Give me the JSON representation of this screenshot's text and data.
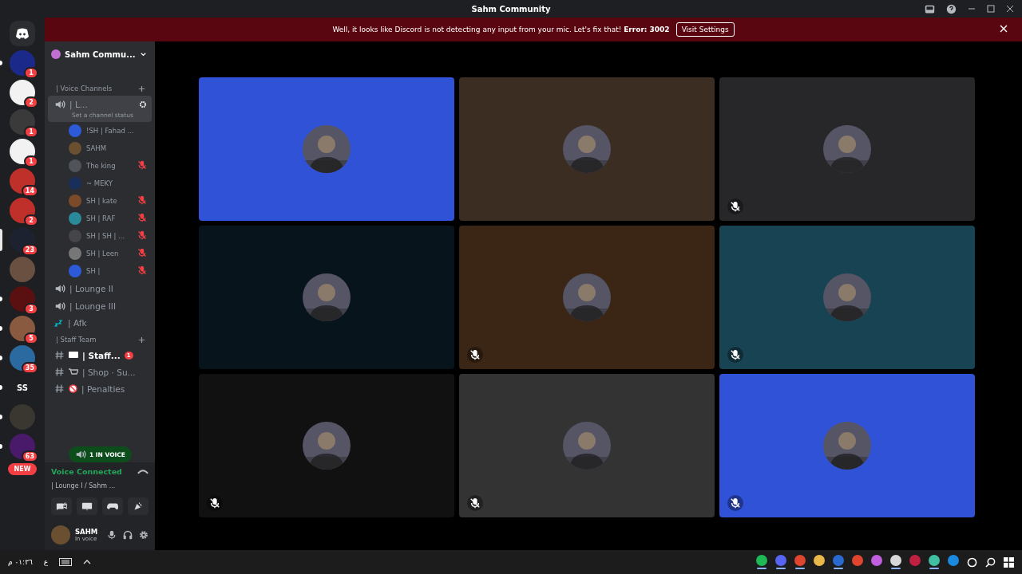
{
  "window": {
    "title": "Sahm Community"
  },
  "banner": {
    "message": "Well, it looks like Discord is not detecting any input from your mic. Let's fix that!  **Error: 3002**",
    "button": "Visit Settings"
  },
  "servers": [
    {
      "badge": "1",
      "color": "#1b2a8a",
      "unread": true,
      "selected": false
    },
    {
      "badge": "2",
      "color": "#f2f2f2",
      "unread": false,
      "selected": false
    },
    {
      "badge": "1",
      "color": "#3a3a3a",
      "unread": false,
      "selected": false
    },
    {
      "badge": "1",
      "color": "#f2f2f2",
      "unread": false,
      "selected": false
    },
    {
      "badge": "14",
      "color": "#c0302a",
      "unread": false,
      "selected": false
    },
    {
      "badge": "2",
      "color": "#c0302a",
      "unread": false,
      "selected": false
    },
    {
      "badge": "23",
      "color": "#1c2230",
      "unread": false,
      "selected": true
    },
    {
      "color": "#6a5040",
      "unread": false,
      "selected": false
    },
    {
      "badge": "3",
      "color": "#5a1010",
      "unread": true,
      "selected": false
    },
    {
      "badge": "5",
      "color": "#8a5a40",
      "unread": true,
      "selected": false
    },
    {
      "badge": "35",
      "color": "#2a6aa0",
      "unread": true,
      "selected": false
    },
    {
      "label": "SS",
      "color": "#1e1f22",
      "unread": true,
      "selected": false
    },
    {
      "color": "#3a3630",
      "unread": true,
      "selected": false
    },
    {
      "badge": "63",
      "color": "#4a1a6a",
      "unread": true,
      "selected": false
    }
  ],
  "new_pill": "NEW",
  "server_header": {
    "name": "Sahm Commu..."
  },
  "categories": [
    {
      "name": "| Voice Channels",
      "channels": [
        {
          "kind": "voice",
          "name": "| L...",
          "selected": true,
          "status": "Set a channel status",
          "members": [
            {
              "name": "!SH | Fahad ...",
              "muted": false,
              "color": "#2d5bd8"
            },
            {
              "name": "SAHM",
              "muted": false,
              "color": "#6a5030"
            },
            {
              "name": "The king",
              "muted": true,
              "color": "#50545a"
            },
            {
              "name": "~ MEKY",
              "muted": false,
              "color": "#1a2e5a"
            },
            {
              "name": "SH | kate",
              "muted": true,
              "color": "#7a4a2a"
            },
            {
              "name": "SH | RAF",
              "muted": true,
              "color": "#2a8a9a"
            },
            {
              "name": "SH | SH | ...",
              "muted": true,
              "color": "#46464a"
            },
            {
              "name": "SH | Leen",
              "muted": true,
              "color": "#777777"
            },
            {
              "name": "SH |",
              "muted": true,
              "color": "#2d5bd8"
            }
          ]
        },
        {
          "kind": "voice",
          "name": "| Lounge II",
          "selected": false
        },
        {
          "kind": "voice",
          "name": "| Lounge III",
          "selected": false
        },
        {
          "kind": "afk",
          "name": "| Afk",
          "selected": false
        }
      ]
    },
    {
      "name": "| Staff Team",
      "channels": [
        {
          "kind": "text",
          "name": "| Staff...",
          "selected": false,
          "unread": true,
          "badge": "1"
        },
        {
          "kind": "shop",
          "name": "| Shop · Su...",
          "selected": false,
          "unread": false
        },
        {
          "kind": "blocked",
          "name": "| Penalties",
          "selected": false,
          "unread": false
        }
      ]
    }
  ],
  "voice_pill": "1 IN VOICE",
  "voice_panel": {
    "status": "Voice Connected",
    "channel": "| Lounge I / Sahm ..."
  },
  "user": {
    "name": "SAHM",
    "status": "In voice"
  },
  "tiles": [
    {
      "color": "#2f52d6",
      "muted": false
    },
    {
      "color": "#3b2d21",
      "muted": false
    },
    {
      "color": "#27272a",
      "muted": true
    },
    {
      "color": "#08141c",
      "muted": false
    },
    {
      "color": "#3b2615",
      "muted": true
    },
    {
      "color": "#184352",
      "muted": true
    },
    {
      "color": "#111111",
      "muted": true
    },
    {
      "color": "#333333",
      "muted": true
    },
    {
      "color": "#2f52d6",
      "muted": true
    }
  ],
  "taskbar": {
    "clock": "٠١:٣٦ م",
    "language": "ع",
    "apps": [
      {
        "color": "#1db954",
        "running": true
      },
      {
        "color": "#5865f2",
        "running": true
      },
      {
        "color": "#e0452f",
        "running": true
      },
      {
        "color": "#e8b84a",
        "running": false
      },
      {
        "color": "#2a6ad0",
        "running": true
      },
      {
        "color": "#e0452f",
        "running": false
      },
      {
        "color": "#c060e0",
        "running": false
      },
      {
        "color": "#d8d8d8",
        "running": true
      },
      {
        "color": "#c02040",
        "running": false
      },
      {
        "color": "#40c0a0",
        "running": true
      },
      {
        "color": "#1a8ae0",
        "running": false
      }
    ]
  }
}
